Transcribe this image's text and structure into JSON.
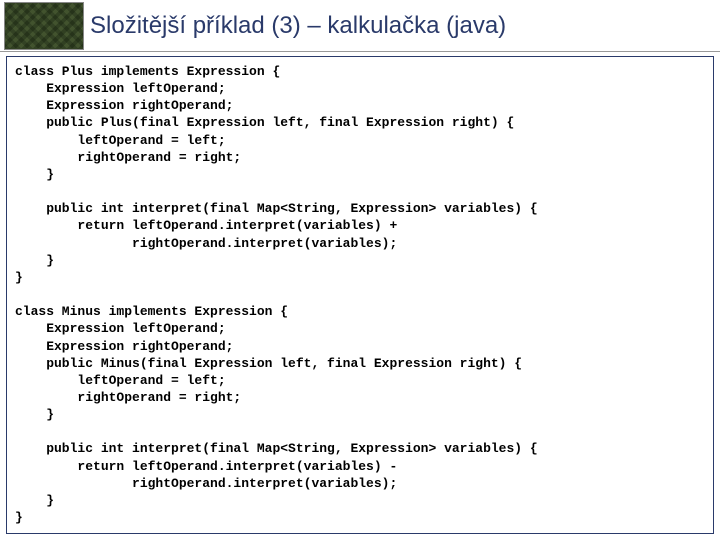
{
  "header": {
    "title": "Složitější příklad (3) – kalkulačka (java)"
  },
  "code": {
    "lines": [
      "class Plus implements Expression {",
      "    Expression leftOperand;",
      "    Expression rightOperand;",
      "    public Plus(final Expression left, final Expression right) {",
      "        leftOperand = left;",
      "        rightOperand = right;",
      "    }",
      "",
      "    public int interpret(final Map<String, Expression> variables) {",
      "        return leftOperand.interpret(variables) +",
      "               rightOperand.interpret(variables);",
      "    }",
      "}",
      "",
      "class Minus implements Expression {",
      "    Expression leftOperand;",
      "    Expression rightOperand;",
      "    public Minus(final Expression left, final Expression right) {",
      "        leftOperand = left;",
      "        rightOperand = right;",
      "    }",
      "",
      "    public int interpret(final Map<String, Expression> variables) {",
      "        return leftOperand.interpret(variables) -",
      "               rightOperand.interpret(variables);",
      "    }",
      "}"
    ]
  }
}
